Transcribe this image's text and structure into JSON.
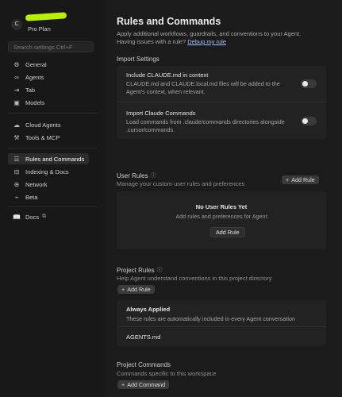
{
  "user": {
    "initial": "C",
    "plan": "Pro Plan",
    "name_color": "#b8f000"
  },
  "search": {
    "placeholder": "Search settings Ctrl+F"
  },
  "sidebar": {
    "items": [
      {
        "label": "General",
        "icon": "gear-icon"
      },
      {
        "label": "Agents",
        "icon": "infinity-icon"
      },
      {
        "label": "Tab",
        "icon": "tab-arrow-icon"
      },
      {
        "label": "Models",
        "icon": "cube-icon"
      },
      {
        "label": "Cloud Agents",
        "icon": "cloud-icon"
      },
      {
        "label": "Tools & MCP",
        "icon": "tools-icon"
      },
      {
        "label": "Rules and Commands",
        "icon": "rules-icon",
        "active": true
      },
      {
        "label": "Indexing & Docs",
        "icon": "indexing-icon"
      },
      {
        "label": "Network",
        "icon": "network-icon"
      },
      {
        "label": "Beta",
        "icon": "beta-icon"
      },
      {
        "label": "Docs",
        "icon": "book-icon"
      }
    ]
  },
  "page": {
    "title": "Rules and Commands",
    "desc": "Apply additional workflows, guardrails, and conventions to your Agent.",
    "desc2_prefix": "Having issues with a rule?",
    "desc2_link": "Debug my rule"
  },
  "import": {
    "heading": "Import Settings",
    "items": [
      {
        "title": "Include CLAUDE.md in context",
        "desc": "CLAUDE.md and CLAUDE.local.md files will be added to the Agent's context, when relevant.",
        "enabled": false
      },
      {
        "title": "Import Claude Commands",
        "desc": "Load commands from .claude/commands directories alongside .cursor/commands.",
        "enabled": false
      }
    ]
  },
  "user_rules": {
    "heading": "User Rules",
    "sub": "Manage your custom user rules and preferences",
    "add_label": "Add Rule",
    "empty_title": "No User Rules Yet",
    "empty_sub": "Add rules and preferences for Agent",
    "empty_button": "Add Rule"
  },
  "project_rules": {
    "heading": "Project Rules",
    "sub": "Help Agent understand conventions in this project directory",
    "add_label": "Add Rule",
    "always_title": "Always Applied",
    "always_sub": "These rules are automatically included in every Agent conversation",
    "file": "AGENTS.md"
  },
  "project_commands": {
    "heading": "Project Commands",
    "sub": "Commands specific to this workspace",
    "add_label": "Add Command"
  }
}
